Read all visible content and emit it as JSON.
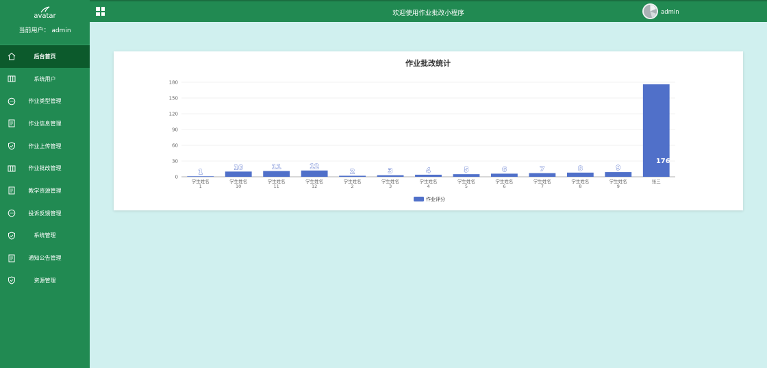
{
  "sidebar": {
    "logo_text": "avatar",
    "current_user": "当前用户：  admin",
    "items": [
      {
        "label": "后台首页",
        "icon": "home-icon",
        "active": true
      },
      {
        "label": "系统用户",
        "icon": "columns-icon"
      },
      {
        "label": "作业类型管理",
        "icon": "chat-icon"
      },
      {
        "label": "作业信息管理",
        "icon": "document-icon"
      },
      {
        "label": "作业上传管理",
        "icon": "shield-icon"
      },
      {
        "label": "作业批改管理",
        "icon": "columns-icon"
      },
      {
        "label": "教学资源管理",
        "icon": "document-icon"
      },
      {
        "label": "投诉反馈管理",
        "icon": "chat-icon"
      },
      {
        "label": "系统管理",
        "icon": "shield-icon"
      },
      {
        "label": "通知公告管理",
        "icon": "document-icon"
      },
      {
        "label": "资源管理",
        "icon": "shield-icon"
      }
    ]
  },
  "topbar": {
    "title": "欢迎使用作业批改小程序",
    "username": "admin"
  },
  "colors": {
    "sidebar_bg": "#218a52",
    "sidebar_active": "#0c5a2c",
    "page_bg": "#d0f0ef",
    "bar": "#5070c9"
  },
  "chart_data": {
    "type": "bar",
    "title": "作业批改统计",
    "categories": [
      [
        "学生姓名",
        "1"
      ],
      [
        "学生姓名",
        "10"
      ],
      [
        "学生姓名",
        "11"
      ],
      [
        "学生姓名",
        "12"
      ],
      [
        "学生姓名",
        "2"
      ],
      [
        "学生姓名",
        "3"
      ],
      [
        "学生姓名",
        "4"
      ],
      [
        "学生姓名",
        "5"
      ],
      [
        "学生姓名",
        "6"
      ],
      [
        "学生姓名",
        "7"
      ],
      [
        "学生姓名",
        "8"
      ],
      [
        "学生姓名",
        "9"
      ],
      [
        "张三"
      ]
    ],
    "series": [
      {
        "name": "作业评分",
        "values": [
          1,
          10,
          11,
          12,
          2,
          3,
          4,
          5,
          6,
          7,
          8,
          9,
          176
        ]
      }
    ],
    "yticks": [
      0,
      30,
      60,
      90,
      120,
      150,
      180
    ],
    "ylim": [
      0,
      180
    ],
    "grid": true,
    "legend": "bottom-center"
  }
}
